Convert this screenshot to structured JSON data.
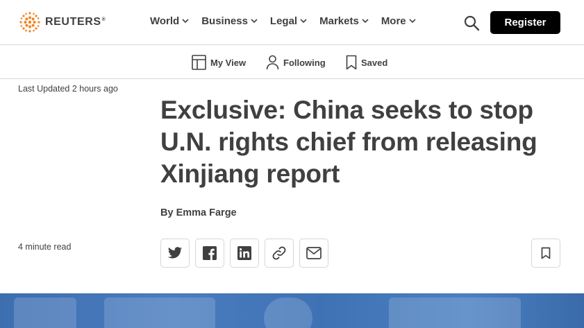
{
  "brand": {
    "name": "REUTERS",
    "reg": "®"
  },
  "nav": {
    "items": [
      {
        "label": "World"
      },
      {
        "label": "Business"
      },
      {
        "label": "Legal"
      },
      {
        "label": "Markets"
      },
      {
        "label": "More"
      }
    ],
    "register_label": "Register"
  },
  "subnav": {
    "my_view": "My View",
    "following": "Following",
    "saved": "Saved"
  },
  "article": {
    "updated_prefix": "Last Updated",
    "updated_time": "2 hours ago",
    "headline": "Exclusive: China seeks to stop U.N. rights chief from releasing Xinjiang report",
    "byline_prefix": "By",
    "author": "Emma Farge",
    "read_time": "4 minute read"
  },
  "share": [
    "twitter-icon",
    "facebook-icon",
    "linkedin-icon",
    "link-icon",
    "email-icon"
  ],
  "colors": {
    "register_bg": "#000000",
    "text": "#404040",
    "logo_orange": "#f58220",
    "divider": "#d6d6d6"
  }
}
